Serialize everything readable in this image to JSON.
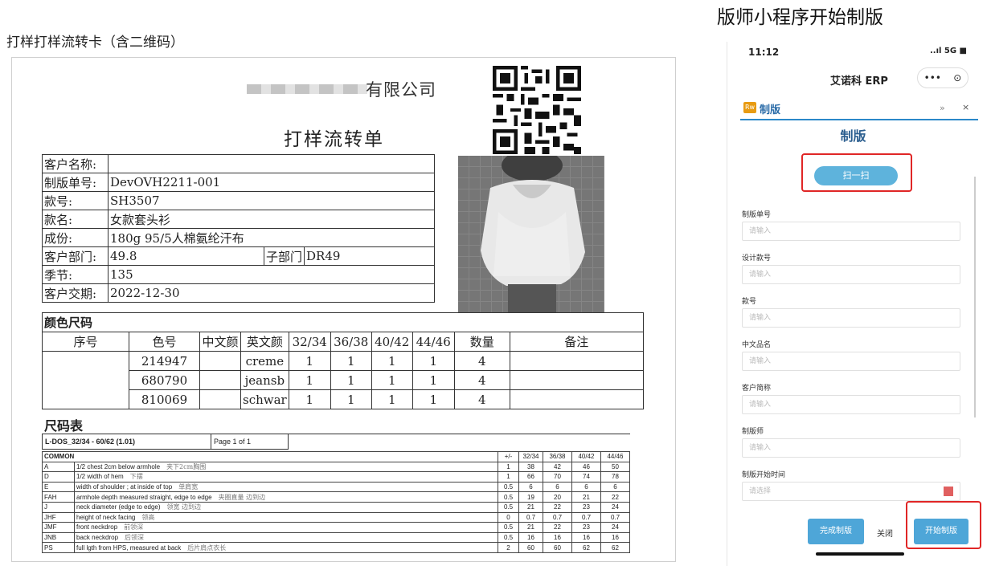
{
  "left_title": "打样打样流转卡（含二维码）",
  "right_title": "版师小程序开始制版",
  "doc": {
    "company_suffix": "有限公司",
    "heading": "打样流转单",
    "info": [
      {
        "label": "客户名称:",
        "value": ""
      },
      {
        "label": "制版单号:",
        "value": "DevOVH2211-001"
      },
      {
        "label": "款号:",
        "value": "SH3507"
      },
      {
        "label": "款名:",
        "value": "女款套头衫"
      },
      {
        "label": "成份:",
        "value": "180g 95/5人棉氨纶汗布"
      },
      {
        "label": "客户部门:",
        "value": "49.8"
      },
      {
        "label": "季节:",
        "value": "135"
      },
      {
        "label": "客户交期:",
        "value": "2022-12-30"
      }
    ],
    "sub_dept_label": "子部门",
    "sub_dept_value": "DR49",
    "color_section": "颜色尺码",
    "color_headers": [
      "序号",
      "色号",
      "中文颜",
      "英文颜",
      "32/34",
      "36/38",
      "40/42",
      "44/46",
      "数量",
      "备注"
    ],
    "color_rows": [
      [
        "",
        "214947",
        "",
        "creme",
        "1",
        "1",
        "1",
        "1",
        "4",
        ""
      ],
      [
        "",
        "680790",
        "",
        "jeansb",
        "1",
        "1",
        "1",
        "1",
        "4",
        ""
      ],
      [
        "",
        "810069",
        "",
        "schwar",
        "1",
        "1",
        "1",
        "1",
        "4",
        ""
      ]
    ],
    "size_section": "尺码表",
    "size_code": "L-DOS_32/34 - 60/62 (1.01)",
    "size_page": "Page 1 of 1",
    "size_headers": [
      "COMMON",
      "+/-",
      "32/34",
      "36/38",
      "40/42",
      "44/46"
    ],
    "size_rows": [
      {
        "code": "A",
        "desc": "1/2 chest 2cm below armhole",
        "cn": "夹下2cm胸围",
        "vals": [
          "1",
          "38",
          "42",
          "46",
          "50"
        ]
      },
      {
        "code": "D",
        "desc": "1/2 width of hem",
        "cn": "下摆",
        "vals": [
          "1",
          "66",
          "70",
          "74",
          "78"
        ]
      },
      {
        "code": "E",
        "desc": "width of shoulder ; at inside of top",
        "cn": "单肩宽",
        "vals": [
          "0.5",
          "6",
          "6",
          "6",
          "6"
        ]
      },
      {
        "code": "FAH",
        "desc": "armhole depth measured straight, edge to edge",
        "cn": "夹圈直量 边到边",
        "vals": [
          "0.5",
          "19",
          "20",
          "21",
          "22"
        ]
      },
      {
        "code": "J",
        "desc": "neck diameter (edge to edge)",
        "cn": "领宽 边到边",
        "vals": [
          "0.5",
          "21",
          "22",
          "23",
          "24"
        ]
      },
      {
        "code": "JHF",
        "desc": "height of neck facing",
        "cn": "领高",
        "vals": [
          "0",
          "0.7",
          "0.7",
          "0.7",
          "0.7"
        ]
      },
      {
        "code": "JMF",
        "desc": "front neckdrop",
        "cn": "前领深",
        "vals": [
          "0.5",
          "21",
          "22",
          "23",
          "24"
        ]
      },
      {
        "code": "JNB",
        "desc": "back neckdrop",
        "cn": "后领深",
        "vals": [
          "0.5",
          "16",
          "16",
          "16",
          "16"
        ]
      },
      {
        "code": "PS",
        "desc": "full lgth from HPS, measured at back",
        "cn": "后片肩点衣长",
        "vals": [
          "2",
          "60",
          "60",
          "62",
          "62"
        ]
      }
    ]
  },
  "phone": {
    "time": "11:12",
    "signal": "..ıl 5G ■",
    "nav_title": "艾诺科 ERP",
    "capsule_more": "•••",
    "capsule_close": "⊙",
    "tab_logo": "Rw",
    "tab_label": "制版",
    "tab_arrows": "»",
    "tab_close": "×",
    "form_title": "制版",
    "scan_label": "扫一扫",
    "fields": [
      {
        "label": "制版单号",
        "placeholder": "请输入"
      },
      {
        "label": "设计款号",
        "placeholder": "请输入"
      },
      {
        "label": "款号",
        "placeholder": "请输入"
      },
      {
        "label": "中文品名",
        "placeholder": "请输入"
      },
      {
        "label": "客户简称",
        "placeholder": "请输入"
      },
      {
        "label": "制版师",
        "placeholder": "请输入"
      },
      {
        "label": "制版开始时间",
        "placeholder": "请选择"
      }
    ],
    "done_button": "完成制版",
    "close_button": "关闭",
    "start_button": "开始制版"
  }
}
